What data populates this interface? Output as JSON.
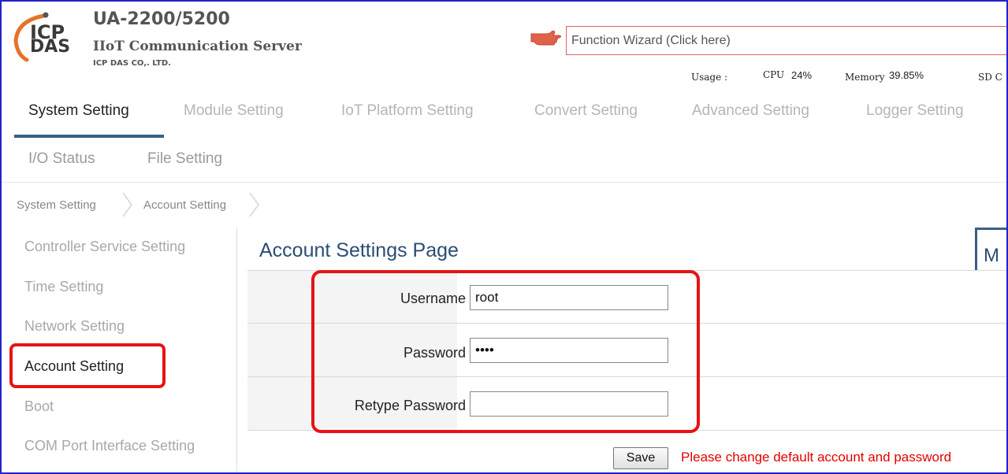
{
  "header": {
    "logo_line1": "ICP",
    "logo_line2": "DAS",
    "title": "UA-2200/5200",
    "subtitle": "IIoT Communication Server",
    "company": "ICP DAS CO,. LTD.",
    "wizard_label": "Function Wizard  (Click here)",
    "usage_label": "Usage :",
    "cpu_label": "CPU",
    "cpu_value": "24%",
    "memory_label": "Memory",
    "memory_value": "39.85%",
    "sd_label": "SD C"
  },
  "nav": {
    "row1": [
      "System Setting",
      "Module Setting",
      "IoT Platform Setting",
      "Convert Setting",
      "Advanced Setting",
      "Logger Setting"
    ],
    "row2": [
      "I/O Status",
      "File Setting"
    ],
    "active": "System Setting"
  },
  "breadcrumb": [
    "System Setting",
    "Account Setting"
  ],
  "sidebar": {
    "items": [
      "Controller Service Setting",
      "Time Setting",
      "Network Setting",
      "Account Setting",
      "Boot",
      "COM Port Interface Setting"
    ],
    "active": "Account Setting"
  },
  "main": {
    "title": "Account Settings Page",
    "tab_stub": "M",
    "fields": [
      {
        "label": "Username",
        "value": "root"
      },
      {
        "label": "Password",
        "value": "••••"
      },
      {
        "label": "Retype Password",
        "value": ""
      }
    ],
    "save_label": "Save",
    "warning": "Please change default account and password"
  },
  "colors": {
    "frame_border": "#2323c9",
    "highlight": "#e81313",
    "title_blue": "#2b4d74",
    "warning_red": "#e40000"
  }
}
